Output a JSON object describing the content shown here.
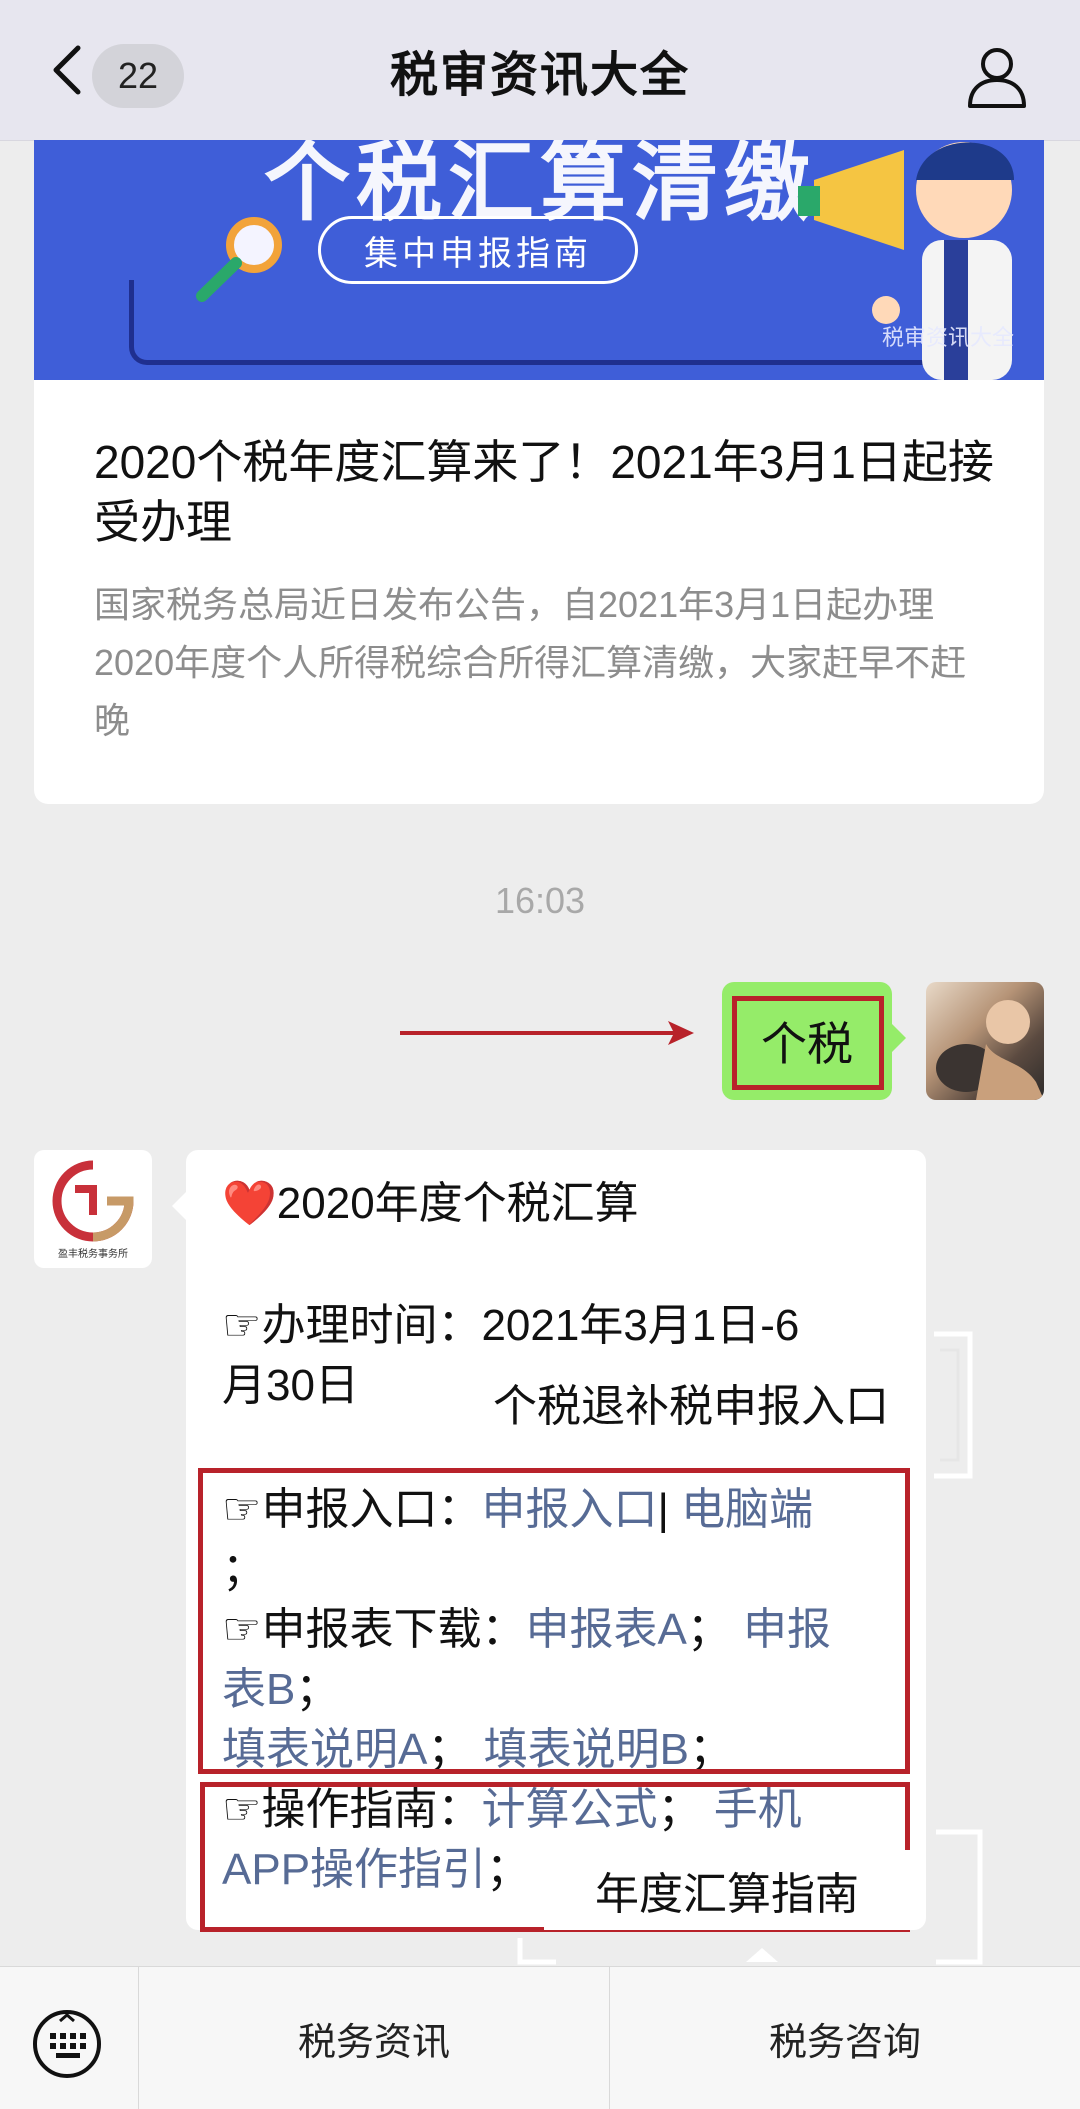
{
  "header": {
    "unread_count": "22",
    "title": "税审资讯大全"
  },
  "article": {
    "banner_title": "个税汇算清缴",
    "banner_pill": "集中申报指南",
    "banner_watermark": "税审资讯大全",
    "title": "2020个税年度汇算来了！2021年3月1日起接受办理",
    "summary": "国家税务总局近日发布公告，自2021年3月1日起办理2020年度个人所得税综合所得汇算清缴，大家赶早不赶晚"
  },
  "timestamp": "16:03",
  "outgoing": {
    "text": "个税"
  },
  "bot": {
    "avatar_caption": "盈丰税务事务所"
  },
  "reply": {
    "heading": "❤️2020年度个税汇算",
    "time_label": "☞办理时间：",
    "time_value_1": "2021年3月1日-6",
    "time_value_2": "月30日",
    "entry_label": "☞申报入口：",
    "entry_link_1": "申报入口",
    "entry_sep": "|",
    "entry_link_2": "电脑端",
    "entry_end": "；",
    "form_label": "☞申报表下载：",
    "form_link_a": "申报表A",
    "form_sep": "；",
    "form_link_b_1": "申报",
    "form_link_b_2": "表B",
    "form_end": "；",
    "fill_a": "填表说明A",
    "fill_sep": "；",
    "fill_b": "填表说明B",
    "fill_end": "；",
    "guide_label": "☞操作指南：",
    "guide_link_1": "计算公式",
    "guide_sep": "；",
    "guide_link_2a": "手机",
    "guide_link_2b": "APP操作指引",
    "guide_end": "；"
  },
  "overlays": {
    "label_1": "个税退补税申报入口",
    "label_2": "年度汇算指南"
  },
  "bottom_menu": {
    "tab_1": "税务资讯",
    "tab_2": "税务咨询"
  },
  "colors": {
    "link": "#576b95",
    "outgoing_bubble": "#95ec69",
    "highlight_box": "#b8222a"
  }
}
